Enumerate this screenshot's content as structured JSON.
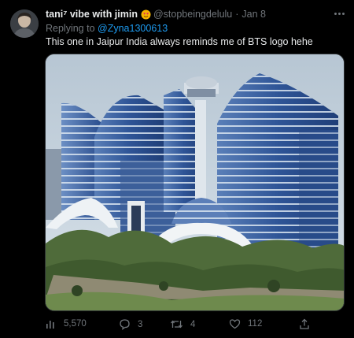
{
  "tweet": {
    "display_name": "tani⁷ vibe with jimin",
    "handle": "@stopbeingdelulu",
    "separator": "·",
    "date": "Jan 8",
    "replying_prefix": "Replying to",
    "replying_to": "@Zyna1300613",
    "text": "This one in Jaipur India always reminds me of BTS logo hehe"
  },
  "actions": {
    "views": "5,570",
    "replies": "3",
    "retweets": "4",
    "likes": "112"
  },
  "icons": {
    "avatar": "avatar-photo",
    "badge": "heart-face-emoji",
    "more": "more-options-icon",
    "views": "views-chart-icon",
    "reply": "reply-bubble-icon",
    "retweet": "retweet-icon",
    "like": "heart-icon",
    "share": "share-upload-icon"
  },
  "colors": {
    "background": "#000000",
    "text": "#e7e9ea",
    "muted": "#71767b",
    "link": "#1d9bf0"
  }
}
